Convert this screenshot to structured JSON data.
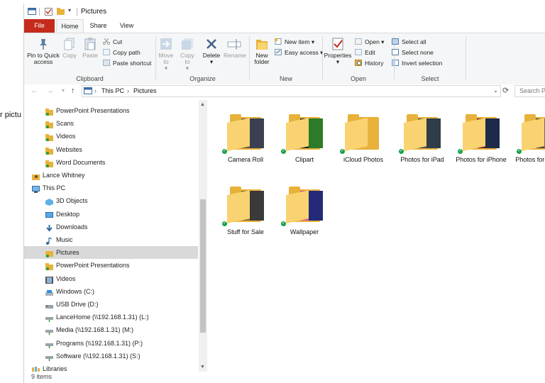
{
  "background_text": "r pictu",
  "window": {
    "title": "Pictures"
  },
  "ribbon": {
    "tabs": {
      "file": "File",
      "home": "Home",
      "share": "Share",
      "view": "View"
    },
    "clipboard": {
      "label": "Clipboard",
      "pin": "Pin to Quick access",
      "copy": "Copy",
      "paste": "Paste",
      "cut": "Cut",
      "copy_path": "Copy path",
      "paste_shortcut": "Paste shortcut"
    },
    "organize": {
      "label": "Organize",
      "move_to": "Move to",
      "copy_to": "Copy to",
      "delete": "Delete",
      "rename": "Rename"
    },
    "new": {
      "label": "New",
      "new_folder": "New folder",
      "new_item": "New item",
      "easy_access": "Easy access"
    },
    "open": {
      "label": "Open",
      "properties": "Properties",
      "open": "Open",
      "edit": "Edit",
      "history": "History"
    },
    "select": {
      "label": "Select",
      "select_all": "Select all",
      "select_none": "Select none",
      "invert": "Invert selection"
    }
  },
  "address": {
    "segments": [
      "This PC",
      "Pictures"
    ],
    "search_placeholder": "Search Pi"
  },
  "nav": {
    "items": [
      {
        "label": "PowerPoint Presentations",
        "icon": "folder-icon"
      },
      {
        "label": "Scans",
        "icon": "folder-icon"
      },
      {
        "label": "Videos",
        "icon": "folder-icon"
      },
      {
        "label": "Websites",
        "icon": "folder-icon"
      },
      {
        "label": "Word Documents",
        "icon": "folder-icon"
      },
      {
        "label": "Lance Whitney",
        "icon": "user-folder-icon"
      },
      {
        "label": "This PC",
        "icon": "computer-icon"
      },
      {
        "label": "3D Objects",
        "icon": "3d-objects-icon"
      },
      {
        "label": "Desktop",
        "icon": "desktop-icon"
      },
      {
        "label": "Downloads",
        "icon": "downloads-icon"
      },
      {
        "label": "Music",
        "icon": "music-icon"
      },
      {
        "label": "Pictures",
        "icon": "pictures-icon"
      },
      {
        "label": "PowerPoint Presentations",
        "icon": "folder-icon"
      },
      {
        "label": "Videos",
        "icon": "videos-icon"
      },
      {
        "label": "Windows (C:)",
        "icon": "drive-icon"
      },
      {
        "label": "USB Drive (D:)",
        "icon": "usb-drive-icon"
      },
      {
        "label": "LanceHome (\\\\192.168.1.31) (L:)",
        "icon": "network-drive-icon"
      },
      {
        "label": "Media (\\\\192.168.1.31) (M:)",
        "icon": "network-drive-icon"
      },
      {
        "label": "Programs (\\\\192.168.1.31) (P:)",
        "icon": "network-drive-icon"
      },
      {
        "label": "Software (\\\\192.168.1.31) (S:)",
        "icon": "network-drive-icon"
      },
      {
        "label": "Libraries",
        "icon": "libraries-icon"
      }
    ],
    "selected": "Pictures"
  },
  "content": {
    "folders": [
      {
        "label": "Camera Roll",
        "thumbs": [
          "#6b5a3a",
          "#3a3f52"
        ]
      },
      {
        "label": "Clipart",
        "thumbs": [
          "#222222",
          "#2d7a2a"
        ]
      },
      {
        "label": "iCloud Photos",
        "thumbs": []
      },
      {
        "label": "Photos for iPad",
        "thumbs": [
          "#4a5058",
          "#2f3d48"
        ]
      },
      {
        "label": "Photos for iPhone",
        "thumbs": [
          "#7a1f1f",
          "#1e2a4a"
        ]
      },
      {
        "label": "Photos for Phone",
        "thumbs": [
          "#444444",
          "#6a6a6a"
        ]
      },
      {
        "label": "Stuff for Sale",
        "thumbs": [
          "#8a6a3a",
          "#3a3a3a"
        ]
      },
      {
        "label": "Wallpaper",
        "thumbs": [
          "#d94fa0",
          "#232a7a"
        ]
      }
    ]
  },
  "status": {
    "item_count": "9 items"
  },
  "colors": {
    "file_tab": "#c42b1c",
    "folder": "#e8b23a",
    "sync_ok": "#17a14a",
    "selection": "#d9d9d9"
  }
}
